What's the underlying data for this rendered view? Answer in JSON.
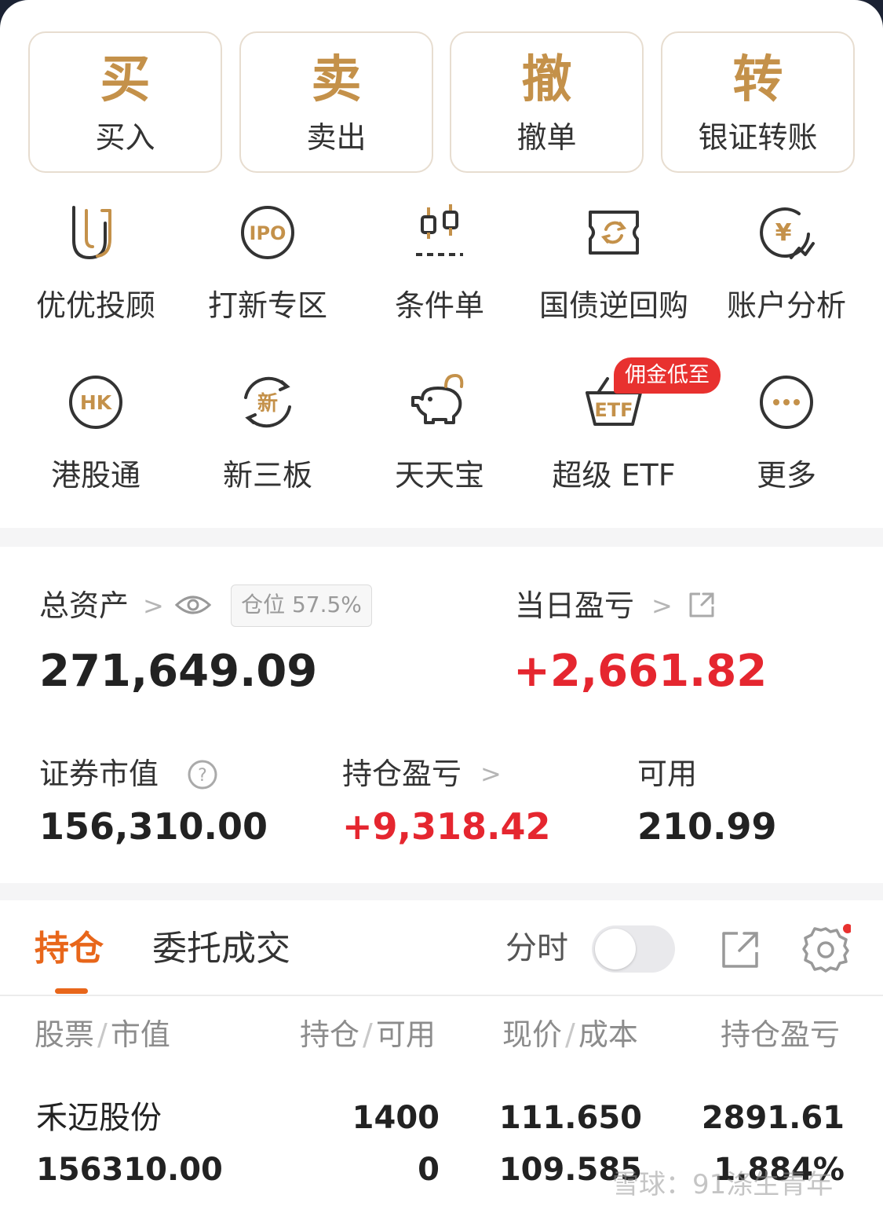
{
  "trade_buttons": [
    {
      "glyph": "买",
      "label": "买入"
    },
    {
      "glyph": "卖",
      "label": "卖出"
    },
    {
      "glyph": "撤",
      "label": "撤单"
    },
    {
      "glyph": "转",
      "label": "银证转账"
    }
  ],
  "grid_row1": [
    {
      "label": "优优投顾",
      "icon": "uu-advisor-icon"
    },
    {
      "label": "打新专区",
      "icon": "ipo-icon"
    },
    {
      "label": "条件单",
      "icon": "conditional-order-icon"
    },
    {
      "label": "国债逆回购",
      "icon": "treasury-repo-icon"
    },
    {
      "label": "账户分析",
      "icon": "account-analysis-icon"
    }
  ],
  "grid_row2": [
    {
      "label": "港股通",
      "icon": "hk-connect-icon"
    },
    {
      "label": "新三板",
      "icon": "neeq-icon"
    },
    {
      "label": "天天宝",
      "icon": "piggy-bank-icon"
    },
    {
      "label": "超级 ETF",
      "icon": "etf-basket-icon"
    },
    {
      "label": "更多",
      "icon": "more-icon"
    }
  ],
  "promo_badge": "佣金低至",
  "assets": {
    "total_label": "总资产",
    "total_value": "271,649.09",
    "position_ratio": "仓位 57.5%",
    "daily_pnl_label": "当日盈亏",
    "daily_pnl_value": "+2,661.82",
    "market_value_label": "证券市值",
    "market_value": "156,310.00",
    "holding_pnl_label": "持仓盈亏",
    "holding_pnl_value": "+9,318.42",
    "available_label": "可用",
    "available_value": "210.99"
  },
  "tabs": {
    "holdings": "持仓",
    "orders": "委托成交",
    "intraday_label": "分时"
  },
  "table": {
    "headers": [
      "股票",
      "/",
      "市值",
      "持仓",
      "/",
      "可用",
      "现价",
      "/",
      "成本",
      "持仓盈亏"
    ],
    "rows": [
      {
        "name": "禾迈股份",
        "market_value": "156310.00",
        "holding": "1400",
        "available": "0",
        "price": "111.650",
        "cost": "109.585",
        "pnl": "2891.61",
        "pnl_pct": "1.884%"
      }
    ]
  },
  "watermark": "雪球：91涤生青年",
  "colors": {
    "gold": "#c4914a",
    "accent_orange": "#e8661a",
    "gain_red": "#e5262f",
    "text_dark": "#222222"
  }
}
